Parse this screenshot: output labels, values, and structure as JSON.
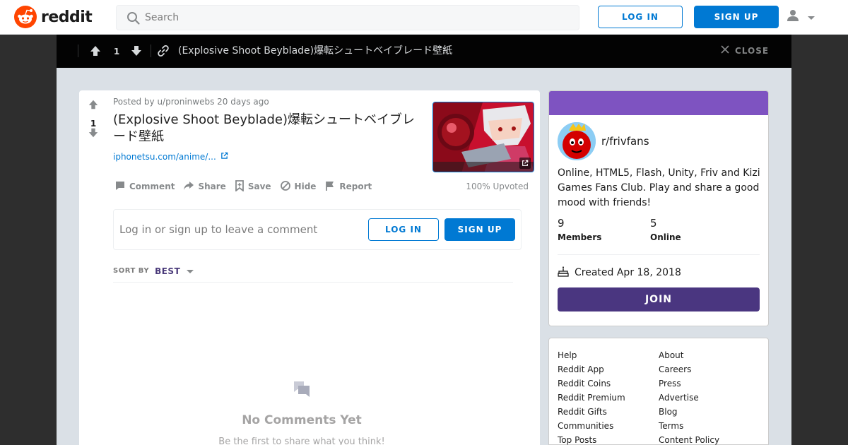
{
  "header": {
    "logo_text": "reddit",
    "search_placeholder": "Search",
    "login_label": "LOG IN",
    "signup_label": "SIGN UP"
  },
  "postbar": {
    "score": "1",
    "title": "(Explosive Shoot Beyblade)爆転シュートベイブレード壁紙",
    "close_label": "CLOSE"
  },
  "post": {
    "score": "1",
    "posted_by": "Posted by u/proninwebs 20 days ago",
    "title": "(Explosive Shoot Beyblade)爆転シュートベイブレード壁紙",
    "link_text": "iphonetsu.com/anime/...",
    "actions": {
      "comment": "Comment",
      "share": "Share",
      "save": "Save",
      "hide": "Hide",
      "report": "Report"
    },
    "upvoted": "100% Upvoted"
  },
  "comment_box": {
    "prompt": "Log in or sign up to leave a comment",
    "login_label": "LOG IN",
    "signup_label": "SIGN UP"
  },
  "sort": {
    "label": "SORT BY",
    "value": "BEST"
  },
  "empty": {
    "title": "No Comments Yet",
    "subtitle": "Be the first to share what you think!"
  },
  "community": {
    "name": "r/frivfans",
    "description": "Online, HTML5, Flash, Unity, Friv and Kizi Games Fans Club. Play and share a good mood with friends!",
    "members_count": "9",
    "members_label": "Members",
    "online_count": "5",
    "online_label": "Online",
    "created": "Created Apr 18, 2018",
    "join_label": "JOIN"
  },
  "footer": {
    "left": [
      "Help",
      "Reddit App",
      "Reddit Coins",
      "Reddit Premium",
      "Reddit Gifts",
      "Communities",
      "Top Posts"
    ],
    "right": [
      "About",
      "Careers",
      "Press",
      "Advertise",
      "Blog",
      "Terms",
      "Content Policy"
    ]
  },
  "colors": {
    "brand": "#ff4500",
    "primary_blue": "#0079d3",
    "community_banner": "#7e53c1",
    "join_button": "#4a3680"
  }
}
